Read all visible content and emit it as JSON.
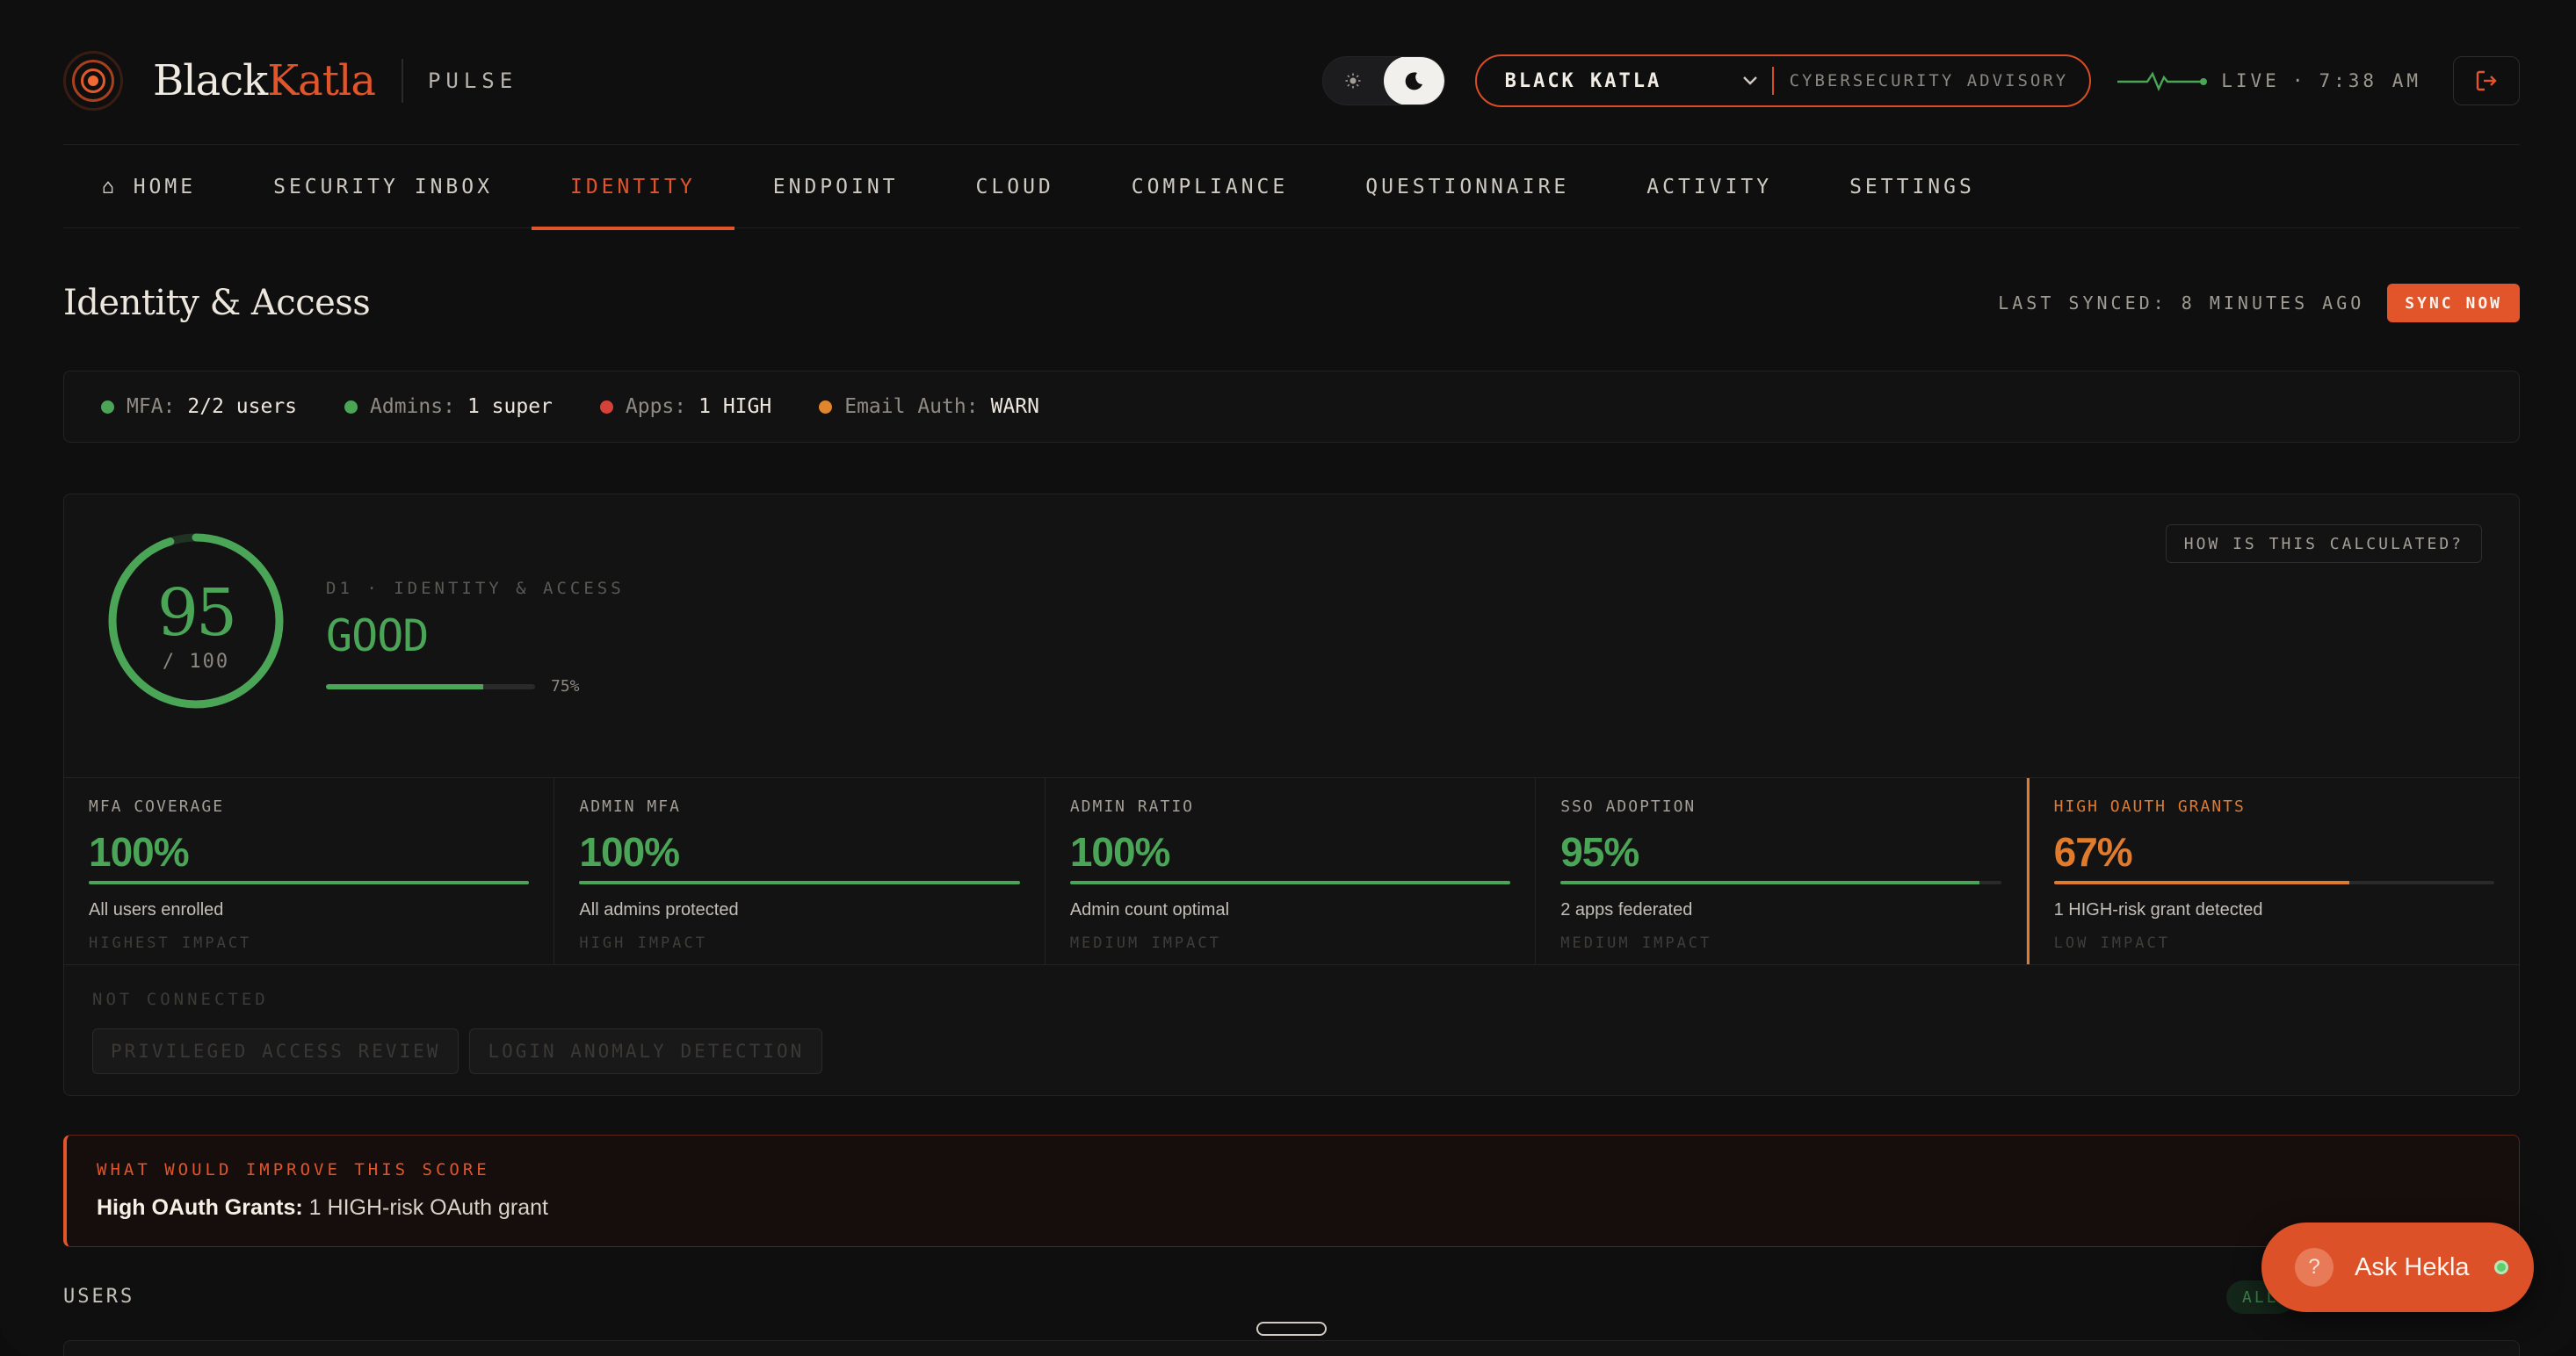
{
  "brand": {
    "name_part1": "Black",
    "name_part2": "Katla",
    "product": "PULSE"
  },
  "header": {
    "org_name": "BLACK KATLA",
    "org_subtitle": "CYBERSECURITY ADVISORY",
    "live_label": "LIVE",
    "live_separator": "·",
    "live_time": "7:38 AM"
  },
  "nav": {
    "items": [
      {
        "label": "⌂ HOME"
      },
      {
        "label": "SECURITY INBOX"
      },
      {
        "label": "IDENTITY"
      },
      {
        "label": "ENDPOINT"
      },
      {
        "label": "CLOUD"
      },
      {
        "label": "COMPLIANCE"
      },
      {
        "label": "QUESTIONNAIRE"
      },
      {
        "label": "ACTIVITY"
      },
      {
        "label": "SETTINGS"
      }
    ],
    "active": "IDENTITY"
  },
  "page": {
    "title": "Identity & Access",
    "last_synced": "LAST SYNCED: 8 MINUTES AGO",
    "sync_button": "SYNC NOW"
  },
  "status": {
    "items": [
      {
        "label": "MFA:",
        "value": "2/2 users",
        "color": "#4aa557"
      },
      {
        "label": "Admins:",
        "value": "1 super",
        "color": "#4aa557"
      },
      {
        "label": "Apps:",
        "value": "1 HIGH",
        "color": "#d8413a"
      },
      {
        "label": "Email Auth:",
        "value": "WARN",
        "color": "#e0862c"
      }
    ]
  },
  "score": {
    "value": "95",
    "denominator": "/ 100",
    "fraction": 0.95,
    "kicker": "D1 · IDENTITY & ACCESS",
    "grade": "GOOD",
    "bar_percent_label": "75%",
    "bar_fraction": 0.75,
    "how_button": "HOW IS THIS CALCULATED?"
  },
  "metrics": [
    {
      "label": "MFA COVERAGE",
      "value": "100%",
      "fraction": 1.0,
      "desc": "All users enrolled",
      "impact": "HIGHEST IMPACT",
      "alert": false
    },
    {
      "label": "ADMIN MFA",
      "value": "100%",
      "fraction": 1.0,
      "desc": "All admins protected",
      "impact": "HIGH IMPACT",
      "alert": false
    },
    {
      "label": "ADMIN RATIO",
      "value": "100%",
      "fraction": 1.0,
      "desc": "Admin count optimal",
      "impact": "MEDIUM IMPACT",
      "alert": false
    },
    {
      "label": "SSO ADOPTION",
      "value": "95%",
      "fraction": 0.95,
      "desc": "2 apps federated",
      "impact": "MEDIUM IMPACT",
      "alert": false
    },
    {
      "label": "HIGH OAUTH GRANTS",
      "value": "67%",
      "fraction": 0.67,
      "desc": "1 HIGH-risk grant detected",
      "impact": "LOW IMPACT",
      "alert": true
    }
  ],
  "not_connected": {
    "label": "NOT CONNECTED",
    "chips": [
      "PRIVILEGED ACCESS REVIEW",
      "LOGIN ANOMALY DETECTION"
    ]
  },
  "improve": {
    "kicker": "WHAT WOULD IMPROVE THIS SCORE",
    "bold": "High OAuth Grants:",
    "text": " 1 HIGH-risk OAuth grant"
  },
  "users": {
    "label": "USERS",
    "filter_chip": "ALL"
  },
  "assistant": {
    "label": "Ask Hekla",
    "icon": "?"
  },
  "colors": {
    "accent": "#e2542a",
    "good": "#4aa557",
    "warn": "#e07a2c"
  }
}
